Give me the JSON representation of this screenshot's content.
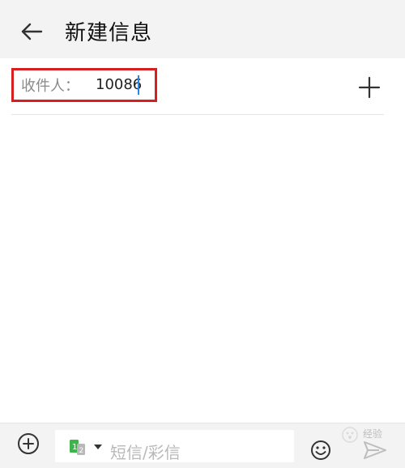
{
  "header": {
    "title": "新建信息",
    "back_icon": "arrow-left-icon"
  },
  "recipient": {
    "label": "收件人：",
    "value": "10086",
    "add_icon": "plus-icon"
  },
  "composer": {
    "attach_icon": "plus-circle-icon",
    "sim_icon": "dual-sim-icon",
    "sim_dropdown_icon": "triangle-down-icon",
    "placeholder": "短信/彩信",
    "emoji_icon": "smiley-icon",
    "send_icon": "send-arrow-icon"
  },
  "watermark": {
    "text": "经验"
  },
  "colors": {
    "highlight_box": "#d81f1f",
    "caret": "#2a86e8",
    "sim_green": "#3cb54a"
  }
}
